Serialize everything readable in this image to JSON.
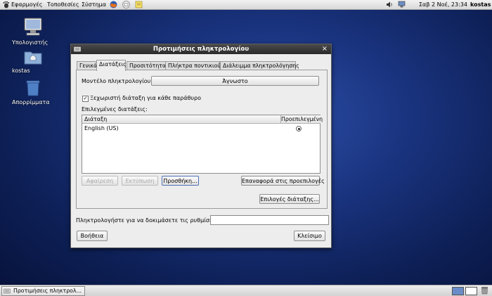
{
  "top_panel": {
    "menus": [
      "Εφαρμογές",
      "Τοποθεσίες",
      "Σύστημα"
    ],
    "clock": "Σαβ  2 Νοέ, 23:34",
    "user": "kostas"
  },
  "desktop": {
    "icons": [
      {
        "label": "Υπολογιστής",
        "icon": "computer-icon"
      },
      {
        "label": "kostas",
        "icon": "home-folder-icon"
      },
      {
        "label": "Απορρίμματα",
        "icon": "trash-icon"
      }
    ]
  },
  "window": {
    "title": "Προτιμήσεις πληκτρολογίου",
    "tabs": [
      "Γενικά",
      "Διατάξεις",
      "Προσιτότητα",
      "Πλήκτρα ποντικιού",
      "Διάλειμμα πληκτρολόγησης"
    ],
    "active_tab": "Διατάξεις",
    "model_label": "Μοντέλο πληκτρολογίου:",
    "model_value": "Άγνωστο",
    "separate_layout_label": "Ξεχωριστή διάταξη για κάθε παράθυρο",
    "separate_layout_checked": true,
    "selected_layouts_label": "Επιλεγμένες διατάξεις:",
    "columns": [
      "Διάταξη",
      "Προεπιλεγμένη"
    ],
    "rows": [
      {
        "layout": "English (US)",
        "default": true
      }
    ],
    "buttons": {
      "remove": "Αφαίρεση",
      "print": "Εκτύπωση",
      "add": "Προσθήκη...",
      "reset": "Επαναφορά στις προεπιλογές",
      "options": "Επιλογές διάταξης..."
    },
    "test_label": "Πληκτρολογήστε για να δοκιμάσετε τις ρυθμίσεις:",
    "test_value": "",
    "help": "Βοήθεια",
    "close": "Κλείσιμο"
  },
  "taskbar": {
    "task": "Προτιμήσεις πληκτρολ..."
  }
}
